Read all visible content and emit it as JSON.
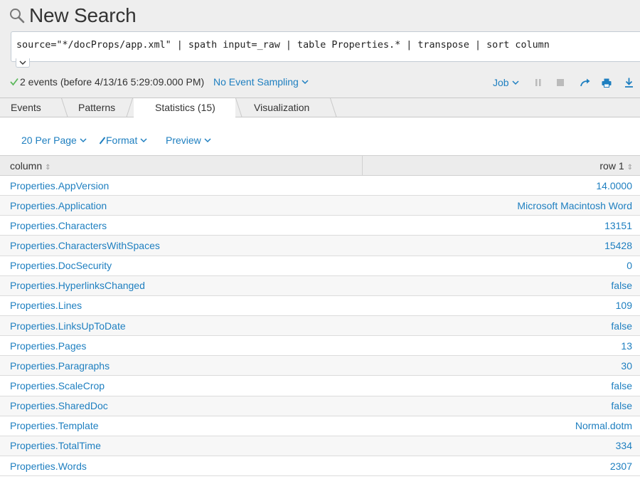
{
  "header": {
    "title": "New Search"
  },
  "search": {
    "query": "source=\"*/docProps/app.xml\" | spath input=_raw | table Properties.* | transpose | sort column"
  },
  "status": {
    "events": "2 events (before 4/13/16 5:29:09.000 PM)",
    "sampling": "No Event Sampling",
    "job": "Job"
  },
  "tabs": [
    {
      "label": "Events"
    },
    {
      "label": "Patterns"
    },
    {
      "label": "Statistics (15)"
    },
    {
      "label": "Visualization"
    }
  ],
  "controls": {
    "per_page": "20 Per Page",
    "format": "Format",
    "preview": "Preview"
  },
  "table": {
    "columns": [
      "column",
      "row 1"
    ],
    "rows": [
      [
        "Properties.AppVersion",
        "14.0000"
      ],
      [
        "Properties.Application",
        "Microsoft Macintosh Word"
      ],
      [
        "Properties.Characters",
        "13151"
      ],
      [
        "Properties.CharactersWithSpaces",
        "15428"
      ],
      [
        "Properties.DocSecurity",
        "0"
      ],
      [
        "Properties.HyperlinksChanged",
        "false"
      ],
      [
        "Properties.Lines",
        "109"
      ],
      [
        "Properties.LinksUpToDate",
        "false"
      ],
      [
        "Properties.Pages",
        "13"
      ],
      [
        "Properties.Paragraphs",
        "30"
      ],
      [
        "Properties.ScaleCrop",
        "false"
      ],
      [
        "Properties.SharedDoc",
        "false"
      ],
      [
        "Properties.Template",
        "Normal.dotm"
      ],
      [
        "Properties.TotalTime",
        "334"
      ],
      [
        "Properties.Words",
        "2307"
      ]
    ]
  },
  "colors": {
    "link": "#1e7fc0",
    "success": "#5cb85c"
  }
}
